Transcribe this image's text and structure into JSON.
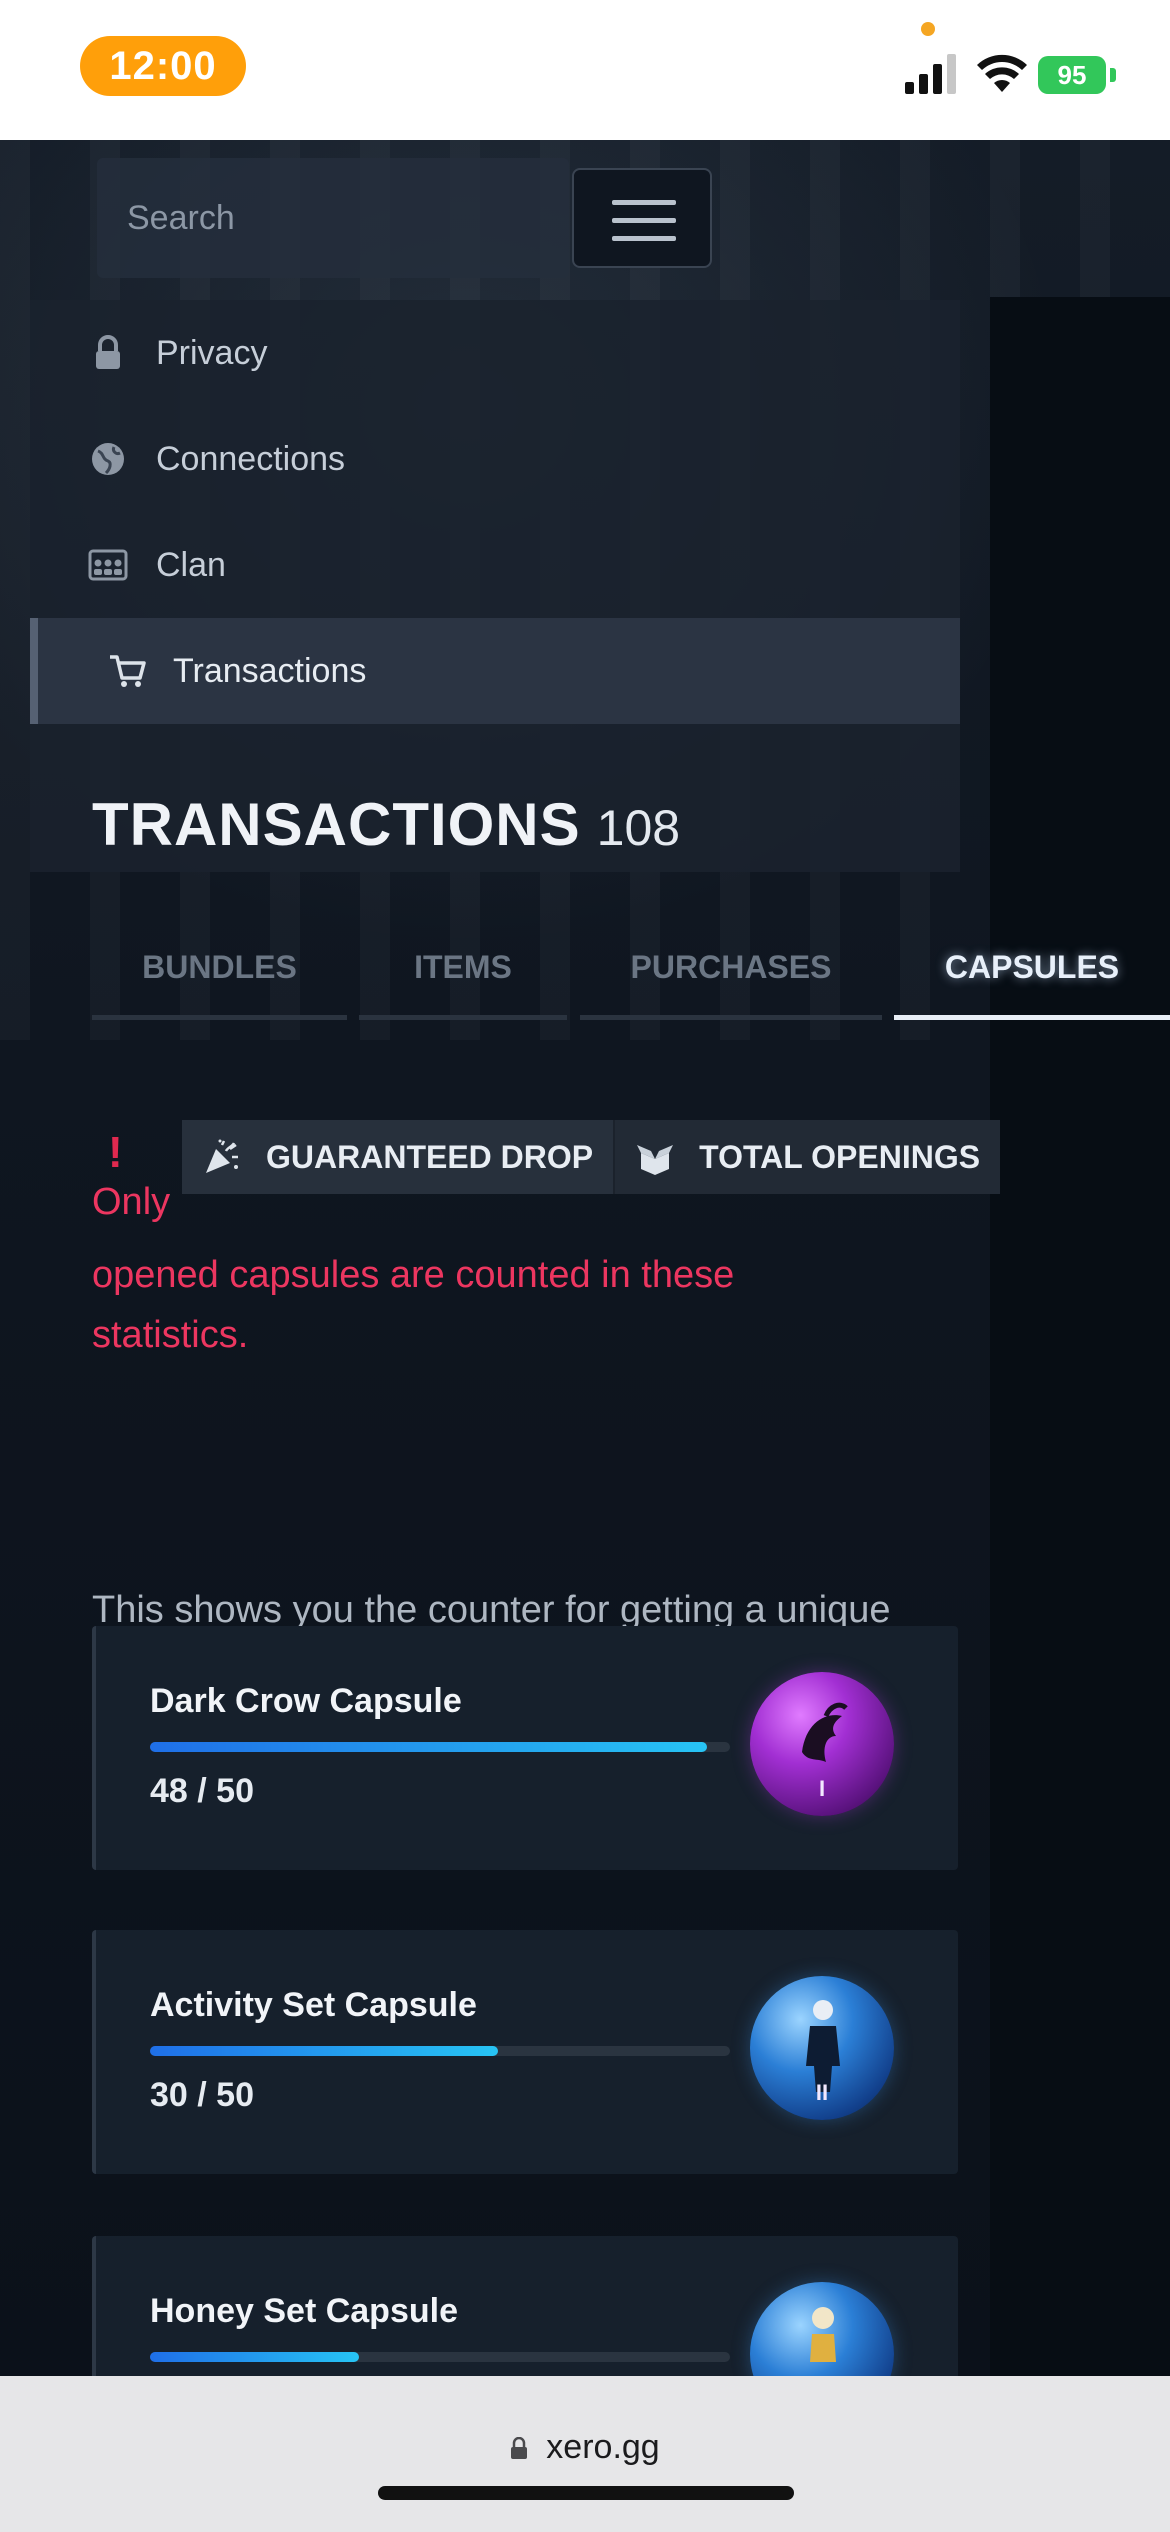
{
  "status_bar": {
    "time": "12:00",
    "battery": "95"
  },
  "header": {
    "search_placeholder": "Search"
  },
  "side_menu": {
    "items": [
      {
        "label": "Privacy",
        "icon": "lock-icon"
      },
      {
        "label": "Connections",
        "icon": "globe-icon"
      },
      {
        "label": "Clan",
        "icon": "group-icon"
      },
      {
        "label": "Transactions",
        "icon": "cart-icon",
        "active": true
      }
    ]
  },
  "page": {
    "title": "TRANSACTIONS",
    "count": "108"
  },
  "tabs": [
    {
      "label": "BUNDLES"
    },
    {
      "label": "ITEMS"
    },
    {
      "label": "PURCHASES"
    },
    {
      "label": "CAPSULES",
      "active": true
    }
  ],
  "info": {
    "alert_mark": "!",
    "badges": [
      {
        "label": "GUARANTEED DROP",
        "icon": "party-popper-icon"
      },
      {
        "label": "TOTAL OPENINGS",
        "icon": "open-box-icon"
      }
    ],
    "warning_line1": "Only",
    "warning_line2": "opened capsules are counted in these",
    "warning_line3": "statistics.",
    "description": "This shows you the counter for getting a unique item from the capsule."
  },
  "capsules": [
    {
      "name": "Dark Crow Capsule",
      "progress": "48 / 50",
      "current": 48,
      "max": 50,
      "tier": "I",
      "orb_color": "purple"
    },
    {
      "name": "Activity Set Capsule",
      "progress": "30 / 50",
      "current": 30,
      "max": 50,
      "tier": "II",
      "orb_color": "blue"
    },
    {
      "name": "Honey Set Capsule",
      "progress": "",
      "current": 18,
      "max": 50,
      "tier": "",
      "orb_color": "blue"
    }
  ],
  "browser": {
    "url": "xero.gg"
  },
  "colors": {
    "accent_orange": "#ff9f0a",
    "battery_green": "#32c75a",
    "warning_red": "#ec3660",
    "progress_start": "#1f6fe8",
    "progress_end": "#27c4f4"
  }
}
